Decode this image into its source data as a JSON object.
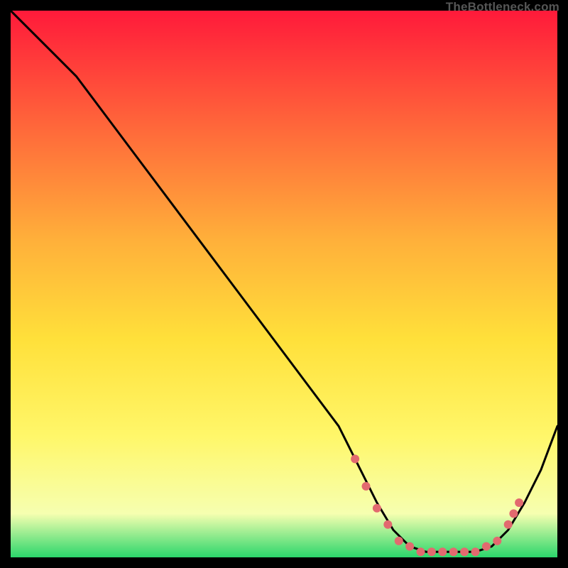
{
  "attribution": "TheBottleneck.com",
  "colors": {
    "bg_black": "#000000",
    "curve": "#000000",
    "dot": "#e26a6f",
    "grad_top": "#ff1a3a",
    "grad_mid1": "#ff6a3a",
    "grad_mid2": "#ffb03a",
    "grad_mid3": "#ffe03a",
    "grad_mid4": "#fff76a",
    "grad_mid5": "#f6ffb0",
    "grad_bot": "#2bd66b"
  },
  "chart_data": {
    "type": "line",
    "title": "",
    "xlabel": "",
    "ylabel": "",
    "xlim": [
      0,
      100
    ],
    "ylim": [
      0,
      100
    ],
    "series": [
      {
        "name": "bottleneck-curve",
        "x": [
          0,
          8,
          12,
          18,
          24,
          30,
          36,
          42,
          48,
          54,
          60,
          64,
          67,
          70,
          73,
          76,
          79,
          82,
          85,
          88,
          91,
          94,
          97,
          100
        ],
        "y": [
          100,
          92,
          88,
          80,
          72,
          64,
          56,
          48,
          40,
          32,
          24,
          16,
          10,
          5,
          2,
          1,
          1,
          1,
          1,
          2,
          5,
          10,
          16,
          24
        ]
      }
    ],
    "points": {
      "name": "highlighted-dots",
      "x": [
        63,
        65,
        67,
        69,
        71,
        73,
        75,
        77,
        79,
        81,
        83,
        85,
        87,
        89,
        91,
        92,
        93
      ],
      "y": [
        18,
        13,
        9,
        6,
        3,
        2,
        1,
        1,
        1,
        1,
        1,
        1,
        2,
        3,
        6,
        8,
        10
      ]
    }
  }
}
